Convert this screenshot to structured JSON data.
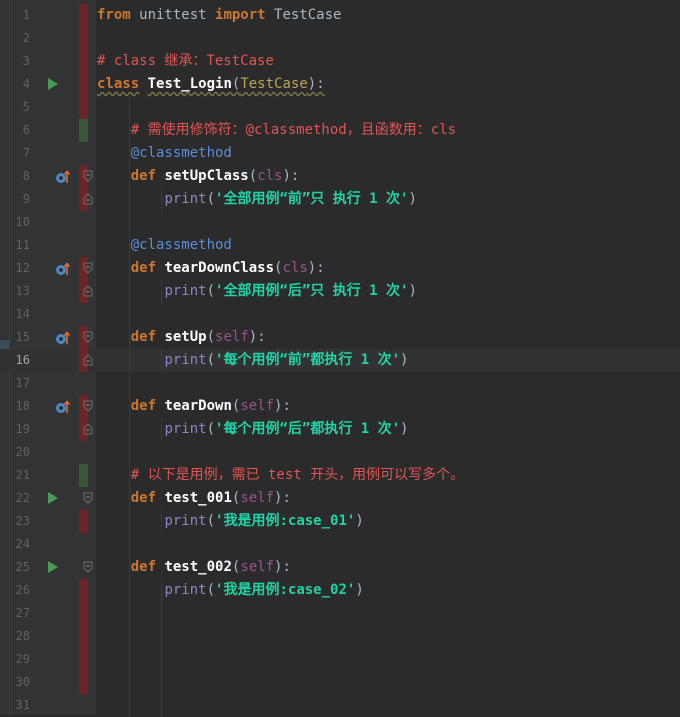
{
  "editor": {
    "current_line": 16,
    "lines": [
      {
        "n": "1",
        "tokens": [
          {
            "t": "from",
            "c": "kw"
          },
          {
            "t": " unittest ",
            "c": "plain"
          },
          {
            "t": "import",
            "c": "kw"
          },
          {
            "t": " TestCase",
            "c": "plain"
          }
        ]
      },
      {
        "n": "2",
        "tokens": []
      },
      {
        "n": "3",
        "tokens": [
          {
            "t": "# class 继承：TestCase",
            "c": "comment"
          }
        ]
      },
      {
        "n": "4",
        "tokens": [
          {
            "t": "class",
            "c": "kw"
          },
          {
            "t": " ",
            "c": "plain"
          },
          {
            "t": "Test_Login",
            "c": "fn"
          },
          {
            "t": "(",
            "c": "plain"
          },
          {
            "t": "TestCase",
            "c": "base"
          },
          {
            "t": "):",
            "c": "plain"
          }
        ]
      },
      {
        "n": "5",
        "tokens": []
      },
      {
        "n": "6",
        "tokens": [
          {
            "t": "    # 需使用修饰符：@classmethod，且函数用：cls",
            "c": "comment"
          }
        ]
      },
      {
        "n": "7",
        "tokens": [
          {
            "t": "    @classmethod",
            "c": "deco"
          }
        ]
      },
      {
        "n": "8",
        "tokens": [
          {
            "t": "    ",
            "c": "plain"
          },
          {
            "t": "def",
            "c": "kw"
          },
          {
            "t": " ",
            "c": "plain"
          },
          {
            "t": "setUpClass",
            "c": "fn"
          },
          {
            "t": "(",
            "c": "plain"
          },
          {
            "t": "cls",
            "c": "param"
          },
          {
            "t": "):",
            "c": "plain"
          }
        ]
      },
      {
        "n": "9",
        "tokens": [
          {
            "t": "        ",
            "c": "plain"
          },
          {
            "t": "print",
            "c": "builtin"
          },
          {
            "t": "(",
            "c": "plain"
          },
          {
            "t": "'全部用例“前”只 执行 1 次'",
            "c": "str"
          },
          {
            "t": ")",
            "c": "plain"
          }
        ]
      },
      {
        "n": "10",
        "tokens": []
      },
      {
        "n": "11",
        "tokens": [
          {
            "t": "    @classmethod",
            "c": "deco"
          }
        ]
      },
      {
        "n": "12",
        "tokens": [
          {
            "t": "    ",
            "c": "plain"
          },
          {
            "t": "def",
            "c": "kw"
          },
          {
            "t": " ",
            "c": "plain"
          },
          {
            "t": "tearDownClass",
            "c": "fn"
          },
          {
            "t": "(",
            "c": "plain"
          },
          {
            "t": "cls",
            "c": "param"
          },
          {
            "t": "):",
            "c": "plain"
          }
        ]
      },
      {
        "n": "13",
        "tokens": [
          {
            "t": "        ",
            "c": "plain"
          },
          {
            "t": "print",
            "c": "builtin"
          },
          {
            "t": "(",
            "c": "plain"
          },
          {
            "t": "'全部用例“后”只 执行 1 次'",
            "c": "str"
          },
          {
            "t": ")",
            "c": "plain"
          }
        ]
      },
      {
        "n": "14",
        "tokens": []
      },
      {
        "n": "15",
        "tokens": [
          {
            "t": "    ",
            "c": "plain"
          },
          {
            "t": "def",
            "c": "kw"
          },
          {
            "t": " ",
            "c": "plain"
          },
          {
            "t": "setUp",
            "c": "fn"
          },
          {
            "t": "(",
            "c": "plain"
          },
          {
            "t": "self",
            "c": "param"
          },
          {
            "t": "):",
            "c": "plain"
          }
        ]
      },
      {
        "n": "16",
        "tokens": [
          {
            "t": "        ",
            "c": "plain"
          },
          {
            "t": "print",
            "c": "builtin"
          },
          {
            "t": "(",
            "c": "plain"
          },
          {
            "t": "'每个用例“前”都执行 1 次'",
            "c": "str"
          },
          {
            "t": ")",
            "c": "plain"
          }
        ]
      },
      {
        "n": "17",
        "tokens": []
      },
      {
        "n": "18",
        "tokens": [
          {
            "t": "    ",
            "c": "plain"
          },
          {
            "t": "def",
            "c": "kw"
          },
          {
            "t": " ",
            "c": "plain"
          },
          {
            "t": "tearDown",
            "c": "fn"
          },
          {
            "t": "(",
            "c": "plain"
          },
          {
            "t": "self",
            "c": "param"
          },
          {
            "t": "):",
            "c": "plain"
          }
        ]
      },
      {
        "n": "19",
        "tokens": [
          {
            "t": "        ",
            "c": "plain"
          },
          {
            "t": "print",
            "c": "builtin"
          },
          {
            "t": "(",
            "c": "plain"
          },
          {
            "t": "'每个用例“后”都执行 1 次'",
            "c": "str"
          },
          {
            "t": ")",
            "c": "plain"
          }
        ]
      },
      {
        "n": "20",
        "tokens": []
      },
      {
        "n": "21",
        "tokens": [
          {
            "t": "    # 以下是用例，需已 test 开头，用例可以写多个。",
            "c": "comment"
          }
        ]
      },
      {
        "n": "22",
        "tokens": [
          {
            "t": "    ",
            "c": "plain"
          },
          {
            "t": "def",
            "c": "kw"
          },
          {
            "t": " ",
            "c": "plain"
          },
          {
            "t": "test_001",
            "c": "fn"
          },
          {
            "t": "(",
            "c": "plain"
          },
          {
            "t": "self",
            "c": "param"
          },
          {
            "t": "):",
            "c": "plain"
          }
        ]
      },
      {
        "n": "23",
        "tokens": [
          {
            "t": "        ",
            "c": "plain"
          },
          {
            "t": "print",
            "c": "builtin"
          },
          {
            "t": "(",
            "c": "plain"
          },
          {
            "t": "'我是用例:case_01'",
            "c": "str"
          },
          {
            "t": ")",
            "c": "plain"
          }
        ]
      },
      {
        "n": "24",
        "tokens": []
      },
      {
        "n": "25",
        "tokens": [
          {
            "t": "    ",
            "c": "plain"
          },
          {
            "t": "def",
            "c": "kw"
          },
          {
            "t": " ",
            "c": "plain"
          },
          {
            "t": "test_002",
            "c": "fn"
          },
          {
            "t": "(",
            "c": "plain"
          },
          {
            "t": "self",
            "c": "param"
          },
          {
            "t": "):",
            "c": "plain"
          }
        ]
      },
      {
        "n": "26",
        "tokens": [
          {
            "t": "        ",
            "c": "plain"
          },
          {
            "t": "print",
            "c": "builtin"
          },
          {
            "t": "(",
            "c": "plain"
          },
          {
            "t": "'我是用例:case_02'",
            "c": "str"
          },
          {
            "t": ")",
            "c": "plain"
          }
        ]
      },
      {
        "n": "27",
        "tokens": []
      },
      {
        "n": "28",
        "tokens": []
      },
      {
        "n": "29",
        "tokens": []
      },
      {
        "n": "30",
        "tokens": []
      },
      {
        "n": "31",
        "tokens": []
      }
    ]
  },
  "gutter": {
    "run_icon_lines": [
      4,
      22,
      25
    ],
    "override_icon_lines": [
      8,
      12,
      15,
      18
    ],
    "fold_open_lines": [
      8,
      12,
      15,
      18,
      22,
      25
    ],
    "fold_close_lines": [
      9,
      13,
      16,
      19
    ],
    "modified_lines": [
      1,
      2,
      3,
      4,
      5,
      8,
      9,
      12,
      13,
      15,
      16,
      18,
      19,
      23,
      26,
      27,
      28,
      29,
      30
    ],
    "added_lines": [
      6,
      21
    ],
    "icons": {
      "run": "run-test-icon",
      "override": "override-method-icon",
      "fold": "fold-icon"
    }
  },
  "colors": {
    "background": "#2b2b2b",
    "gutter": "#313335",
    "keyword": "#cc7832",
    "string": "#22d3a6",
    "comment": "#e05555",
    "decorator": "#5a8fd8",
    "param": "#94558d",
    "run": "#499c54",
    "modified": "#6b2525",
    "added": "#375737"
  }
}
